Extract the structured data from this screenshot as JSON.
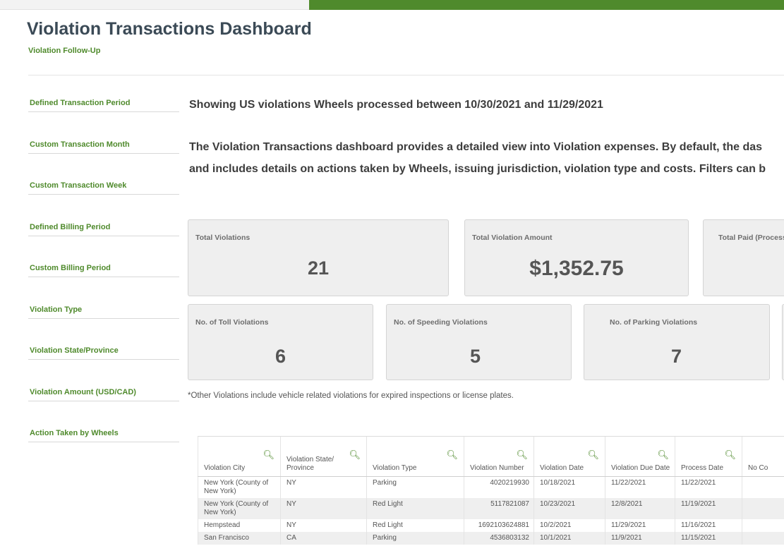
{
  "header": {
    "title": "Violation Transactions Dashboard",
    "subtitle": "Violation Follow-Up"
  },
  "sidebar": {
    "items": [
      {
        "label": "Defined Transaction Period"
      },
      {
        "label": "Custom Transaction Month"
      },
      {
        "label": "Custom Transaction Week"
      },
      {
        "label": "Defined Billing Period"
      },
      {
        "label": "Custom Billing Period"
      },
      {
        "label": "Violation Type"
      },
      {
        "label": "Violation State/Province"
      },
      {
        "label": "Violation Amount (USD/CAD)"
      },
      {
        "label": "Action Taken by Wheels"
      }
    ]
  },
  "main": {
    "period_text": "Showing US violations Wheels processed between 10/30/2021 and 11/29/2021",
    "description_line1": "The Violation Transactions dashboard provides a detailed view into Violation expenses. By default, the das",
    "description_line2": "and includes details on actions taken by Wheels, issuing jurisdiction, violation type and costs. Filters can b",
    "footnote": "*Other Violations include vehicle related violations for expired inspections or license plates."
  },
  "kpis": {
    "total_violations": {
      "label": "Total Violations",
      "value": "21"
    },
    "total_amount": {
      "label": "Total Violation Amount",
      "value": "$1,352.75"
    },
    "total_paid": {
      "label": "Total Paid (Processed"
    },
    "toll": {
      "label": "No. of Toll Violations",
      "value": "6"
    },
    "speeding": {
      "label": "No. of Speeding Violations",
      "value": "5"
    },
    "parking": {
      "label": "No. of Parking Violations",
      "value": "7"
    }
  },
  "table": {
    "columns": [
      {
        "label": "Violation City"
      },
      {
        "label": "Violation State/ Province"
      },
      {
        "label": "Violation Type"
      },
      {
        "label": "Violation Number"
      },
      {
        "label": "Violation Date"
      },
      {
        "label": "Violation Due Date"
      },
      {
        "label": "Process Date"
      },
      {
        "label": "No Co"
      }
    ],
    "rows": [
      {
        "city": "New York (County of New York)",
        "state": "NY",
        "type": "Parking",
        "number": "4020219930",
        "date": "10/18/2021",
        "due": "11/22/2021",
        "process": "11/22/2021"
      },
      {
        "city": "New York (County of New York)",
        "state": "NY",
        "type": "Red Light",
        "number": "5117821087",
        "date": "10/23/2021",
        "due": "12/8/2021",
        "process": "11/19/2021"
      },
      {
        "city": "Hempstead",
        "state": "NY",
        "type": "Red Light",
        "number": "1692103624881",
        "date": "10/2/2021",
        "due": "11/29/2021",
        "process": "11/16/2021"
      },
      {
        "city": "San Francisco",
        "state": "CA",
        "type": "Parking",
        "number": "4536803132",
        "date": "10/1/2021",
        "due": "11/9/2021",
        "process": "11/15/2021"
      }
    ]
  },
  "colors": {
    "brand_green": "#4f8a2c",
    "title_slate": "#3b4a56",
    "card_bg": "#efefef"
  },
  "icons": {
    "column_filter": "search-icon"
  }
}
